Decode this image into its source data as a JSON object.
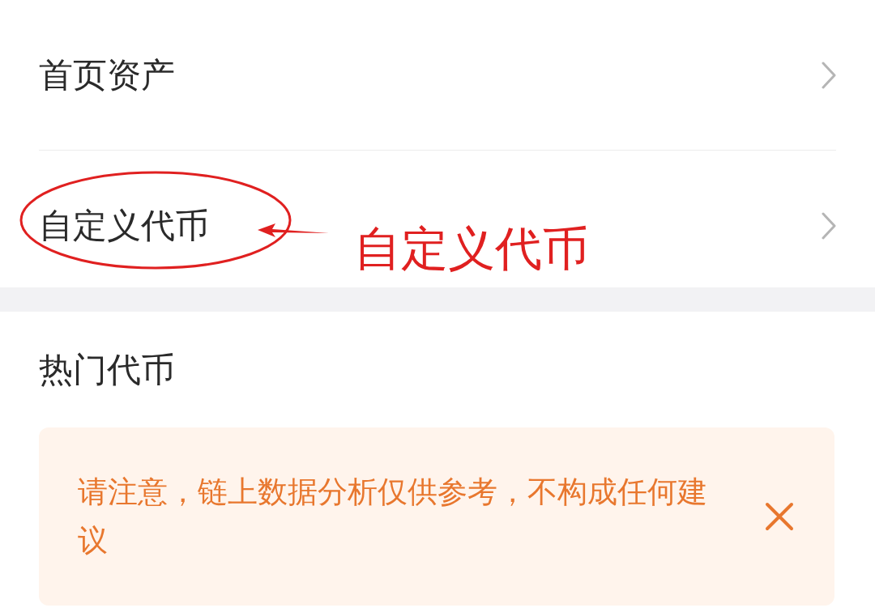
{
  "menu_items": [
    {
      "label": "首页资产"
    },
    {
      "label": "自定义代币"
    }
  ],
  "section": {
    "title": "热门代币"
  },
  "notice": {
    "text": "请注意，链上数据分析仅供参考，不构成任何建议"
  },
  "annotation": {
    "text": "自定义代币"
  }
}
